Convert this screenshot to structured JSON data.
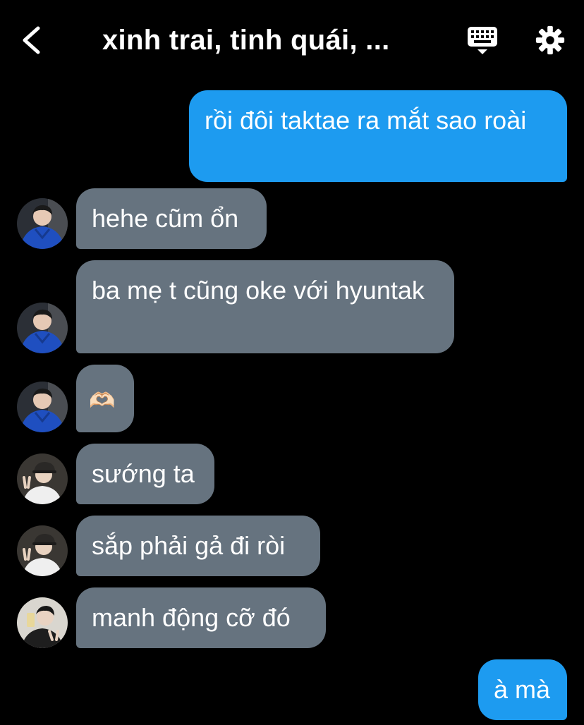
{
  "header": {
    "title": "xinh trai, tinh quái, ...",
    "back_icon": "chevron-left-icon",
    "keyboard_icon": "keyboard-icon",
    "settings_icon": "gear-icon"
  },
  "colors": {
    "background": "#000000",
    "outgoing_bubble": "#1d9bf0",
    "incoming_bubble": "#66737f",
    "text": "#ffffff"
  },
  "messages": [
    {
      "direction": "outgoing",
      "text": "rồi đôi taktae ra mắt sao roài"
    },
    {
      "direction": "incoming",
      "sender_avatar": "avatar-blue-jacket",
      "text": "hehe cũm ổn"
    },
    {
      "direction": "incoming",
      "sender_avatar": "avatar-blue-jacket",
      "text": "ba mẹ t cũng oke với hyuntak"
    },
    {
      "direction": "incoming",
      "sender_avatar": "avatar-blue-jacket",
      "text": "🫶🏻"
    },
    {
      "direction": "incoming",
      "sender_avatar": "avatar-cap-peace",
      "text": "sướng ta"
    },
    {
      "direction": "incoming",
      "sender_avatar": "avatar-cap-peace",
      "text": "sắp phải gả đi ròi"
    },
    {
      "direction": "incoming",
      "sender_avatar": "avatar-mirror-selfie",
      "text": "manh động cỡ đó"
    },
    {
      "direction": "outgoing",
      "text": "à mà"
    }
  ]
}
